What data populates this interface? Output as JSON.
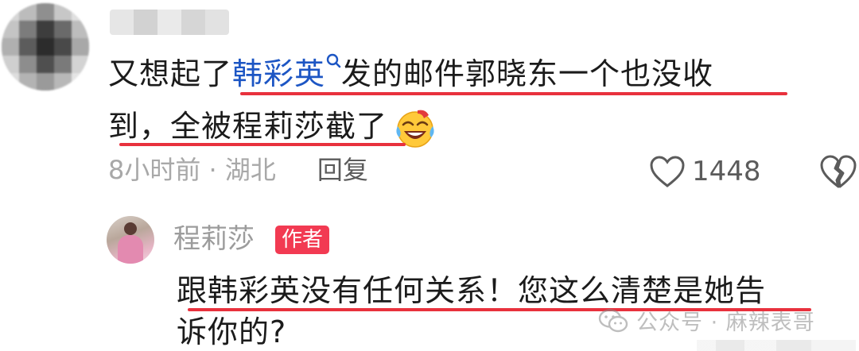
{
  "comment": {
    "line1_before_mention": "又想起了",
    "mention": "韩彩英",
    "line1_after_mention": "发的邮件郭晓东一个也没收",
    "line2": "到，全被程莉莎截了",
    "meta": "8小时前 · 湖北",
    "reply_label": "回复",
    "like_count": "1448"
  },
  "reply": {
    "author_name": "程莉莎",
    "author_badge": "作者",
    "text_line1": "跟韩彩英没有任何关系！您这么清楚是她告",
    "text_line2": "诉你的?"
  },
  "watermark": {
    "text": "公众号 · 麻辣表哥"
  },
  "colors": {
    "mention": "#1d56c4",
    "underline": "#e8313d",
    "badge": "#f23a52"
  },
  "icons": {
    "mention_search": "search-icon",
    "emoji": "laughing-crying-emoji-icon",
    "like": "heart-icon",
    "dislike": "broken-heart-icon",
    "watermark": "wechat-icon"
  }
}
